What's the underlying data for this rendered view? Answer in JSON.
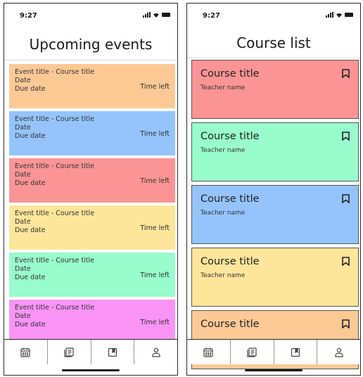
{
  "colors": {
    "orange": "#fcc995",
    "blue": "#94c4fb",
    "red": "#fb9494",
    "yellow": "#fde59a",
    "green": "#98fccc",
    "magenta": "#f994f6"
  },
  "left_screen": {
    "status_time": "9:27",
    "title": "Upcoming events",
    "events": [
      {
        "title": "Event title - Course title",
        "date": "Date",
        "due": "Due date",
        "time_left": "Time left",
        "color": "orange"
      },
      {
        "title": "Event title - Course title",
        "date": "Date",
        "due": "Due date",
        "time_left": "Time left",
        "color": "blue"
      },
      {
        "title": "Event title - Course title",
        "date": "Date",
        "due": "Due date",
        "time_left": "Time left",
        "color": "red"
      },
      {
        "title": "Event title - Course title",
        "date": "Date",
        "due": "Due date",
        "time_left": "Time left",
        "color": "yellow"
      },
      {
        "title": "Event title - Course title",
        "date": "Date",
        "due": "Due date",
        "time_left": "Time left",
        "color": "green"
      },
      {
        "title": "Event title - Course title",
        "date": "Date",
        "due": "Due date",
        "time_left": "Time left",
        "color": "magenta"
      }
    ],
    "nav_tabs": [
      {
        "icon": "calendar-icon",
        "active": false
      },
      {
        "icon": "list-icon",
        "active": false
      },
      {
        "icon": "bookmark-book-icon",
        "active": false
      },
      {
        "icon": "person-icon",
        "active": false
      }
    ]
  },
  "right_screen": {
    "status_time": "9:27",
    "title": "Course list",
    "courses": [
      {
        "title": "Course title",
        "teacher": "Teacher name",
        "color": "red",
        "icon": "bookmark-icon"
      },
      {
        "title": "Course title",
        "teacher": "Teacher name",
        "color": "green",
        "icon": "bookmark-icon"
      },
      {
        "title": "Course title",
        "teacher": "Teacher name",
        "color": "blue",
        "icon": "bookmark-icon"
      },
      {
        "title": "Course title",
        "teacher": "Teacher name",
        "color": "yellow",
        "icon": "bookmark-icon"
      },
      {
        "title": "Course title",
        "teacher": "",
        "color": "orange",
        "icon": "bookmark-icon"
      }
    ],
    "nav_tabs": [
      {
        "icon": "calendar-icon",
        "active": false
      },
      {
        "icon": "list-icon",
        "active": false
      },
      {
        "icon": "bookmark-book-icon",
        "active": false
      },
      {
        "icon": "person-icon",
        "active": false
      }
    ]
  }
}
